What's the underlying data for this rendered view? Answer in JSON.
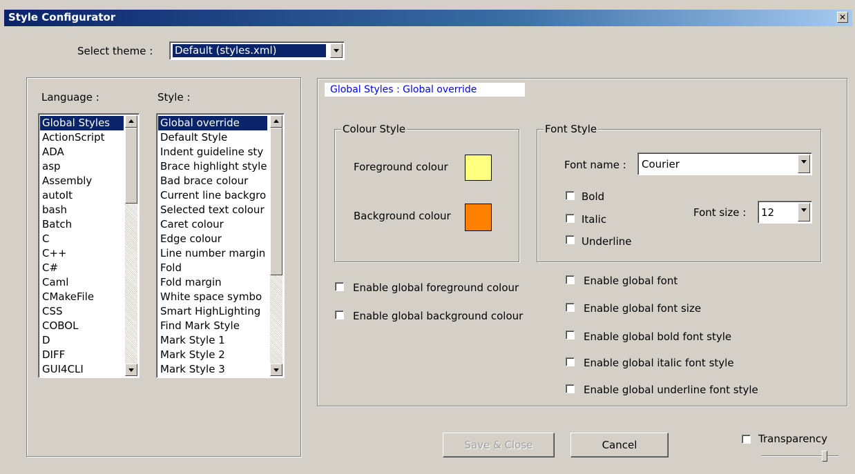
{
  "window": {
    "title": "Style Configurator",
    "close_glyph": "✕"
  },
  "theme": {
    "label": "Select theme :",
    "value": "Default (styles.xml)"
  },
  "language": {
    "label": "Language :",
    "items": [
      "Global Styles",
      "ActionScript",
      "ADA",
      "asp",
      "Assembly",
      "autoIt",
      "bash",
      "Batch",
      "C",
      "C++",
      "C#",
      "Caml",
      "CMakeFile",
      "CSS",
      "COBOL",
      "D",
      "DIFF",
      "GUI4CLI"
    ],
    "selected_index": 0
  },
  "style": {
    "label": "Style :",
    "items": [
      "Global override",
      "Default Style",
      "Indent guideline sty",
      "Brace highlight style",
      "Bad brace colour",
      "Current line backgro",
      "Selected text colour",
      "Caret colour",
      "Edge colour",
      "Line number margin",
      "Fold",
      "Fold margin",
      "White space symbo",
      "Smart HighLighting",
      "Find Mark Style",
      "Mark Style 1",
      "Mark Style 2",
      "Mark Style 3"
    ],
    "selected_index": 0
  },
  "header_text": "Global Styles : Global override",
  "colour_style": {
    "title": "Colour Style",
    "foreground_label": "Foreground colour",
    "background_label": "Background colour",
    "foreground_color": "#ffff80",
    "background_color": "#ff8000"
  },
  "font_style": {
    "title": "Font Style",
    "font_name_label": "Font name :",
    "font_name_value": "Courier",
    "bold_label": "Bold",
    "italic_label": "Italic",
    "underline_label": "Underline",
    "font_size_label": "Font size :",
    "font_size_value": "12"
  },
  "global_options": {
    "fg": "Enable global foreground colour",
    "bg": "Enable global background colour",
    "font": "Enable global font",
    "font_size": "Enable global font size",
    "bold": "Enable global bold font style",
    "italic": "Enable global italic font style",
    "underline": "Enable global underline font style"
  },
  "buttons": {
    "save_close": "Save & Close",
    "cancel": "Cancel"
  },
  "transparency": {
    "label": "Transparency",
    "checked": false,
    "level": 0.85
  },
  "colors": {
    "title_bar": "#0a246a",
    "selection": "#0a246a",
    "header_link": "#0000ff",
    "face": "#d4d0c8"
  }
}
